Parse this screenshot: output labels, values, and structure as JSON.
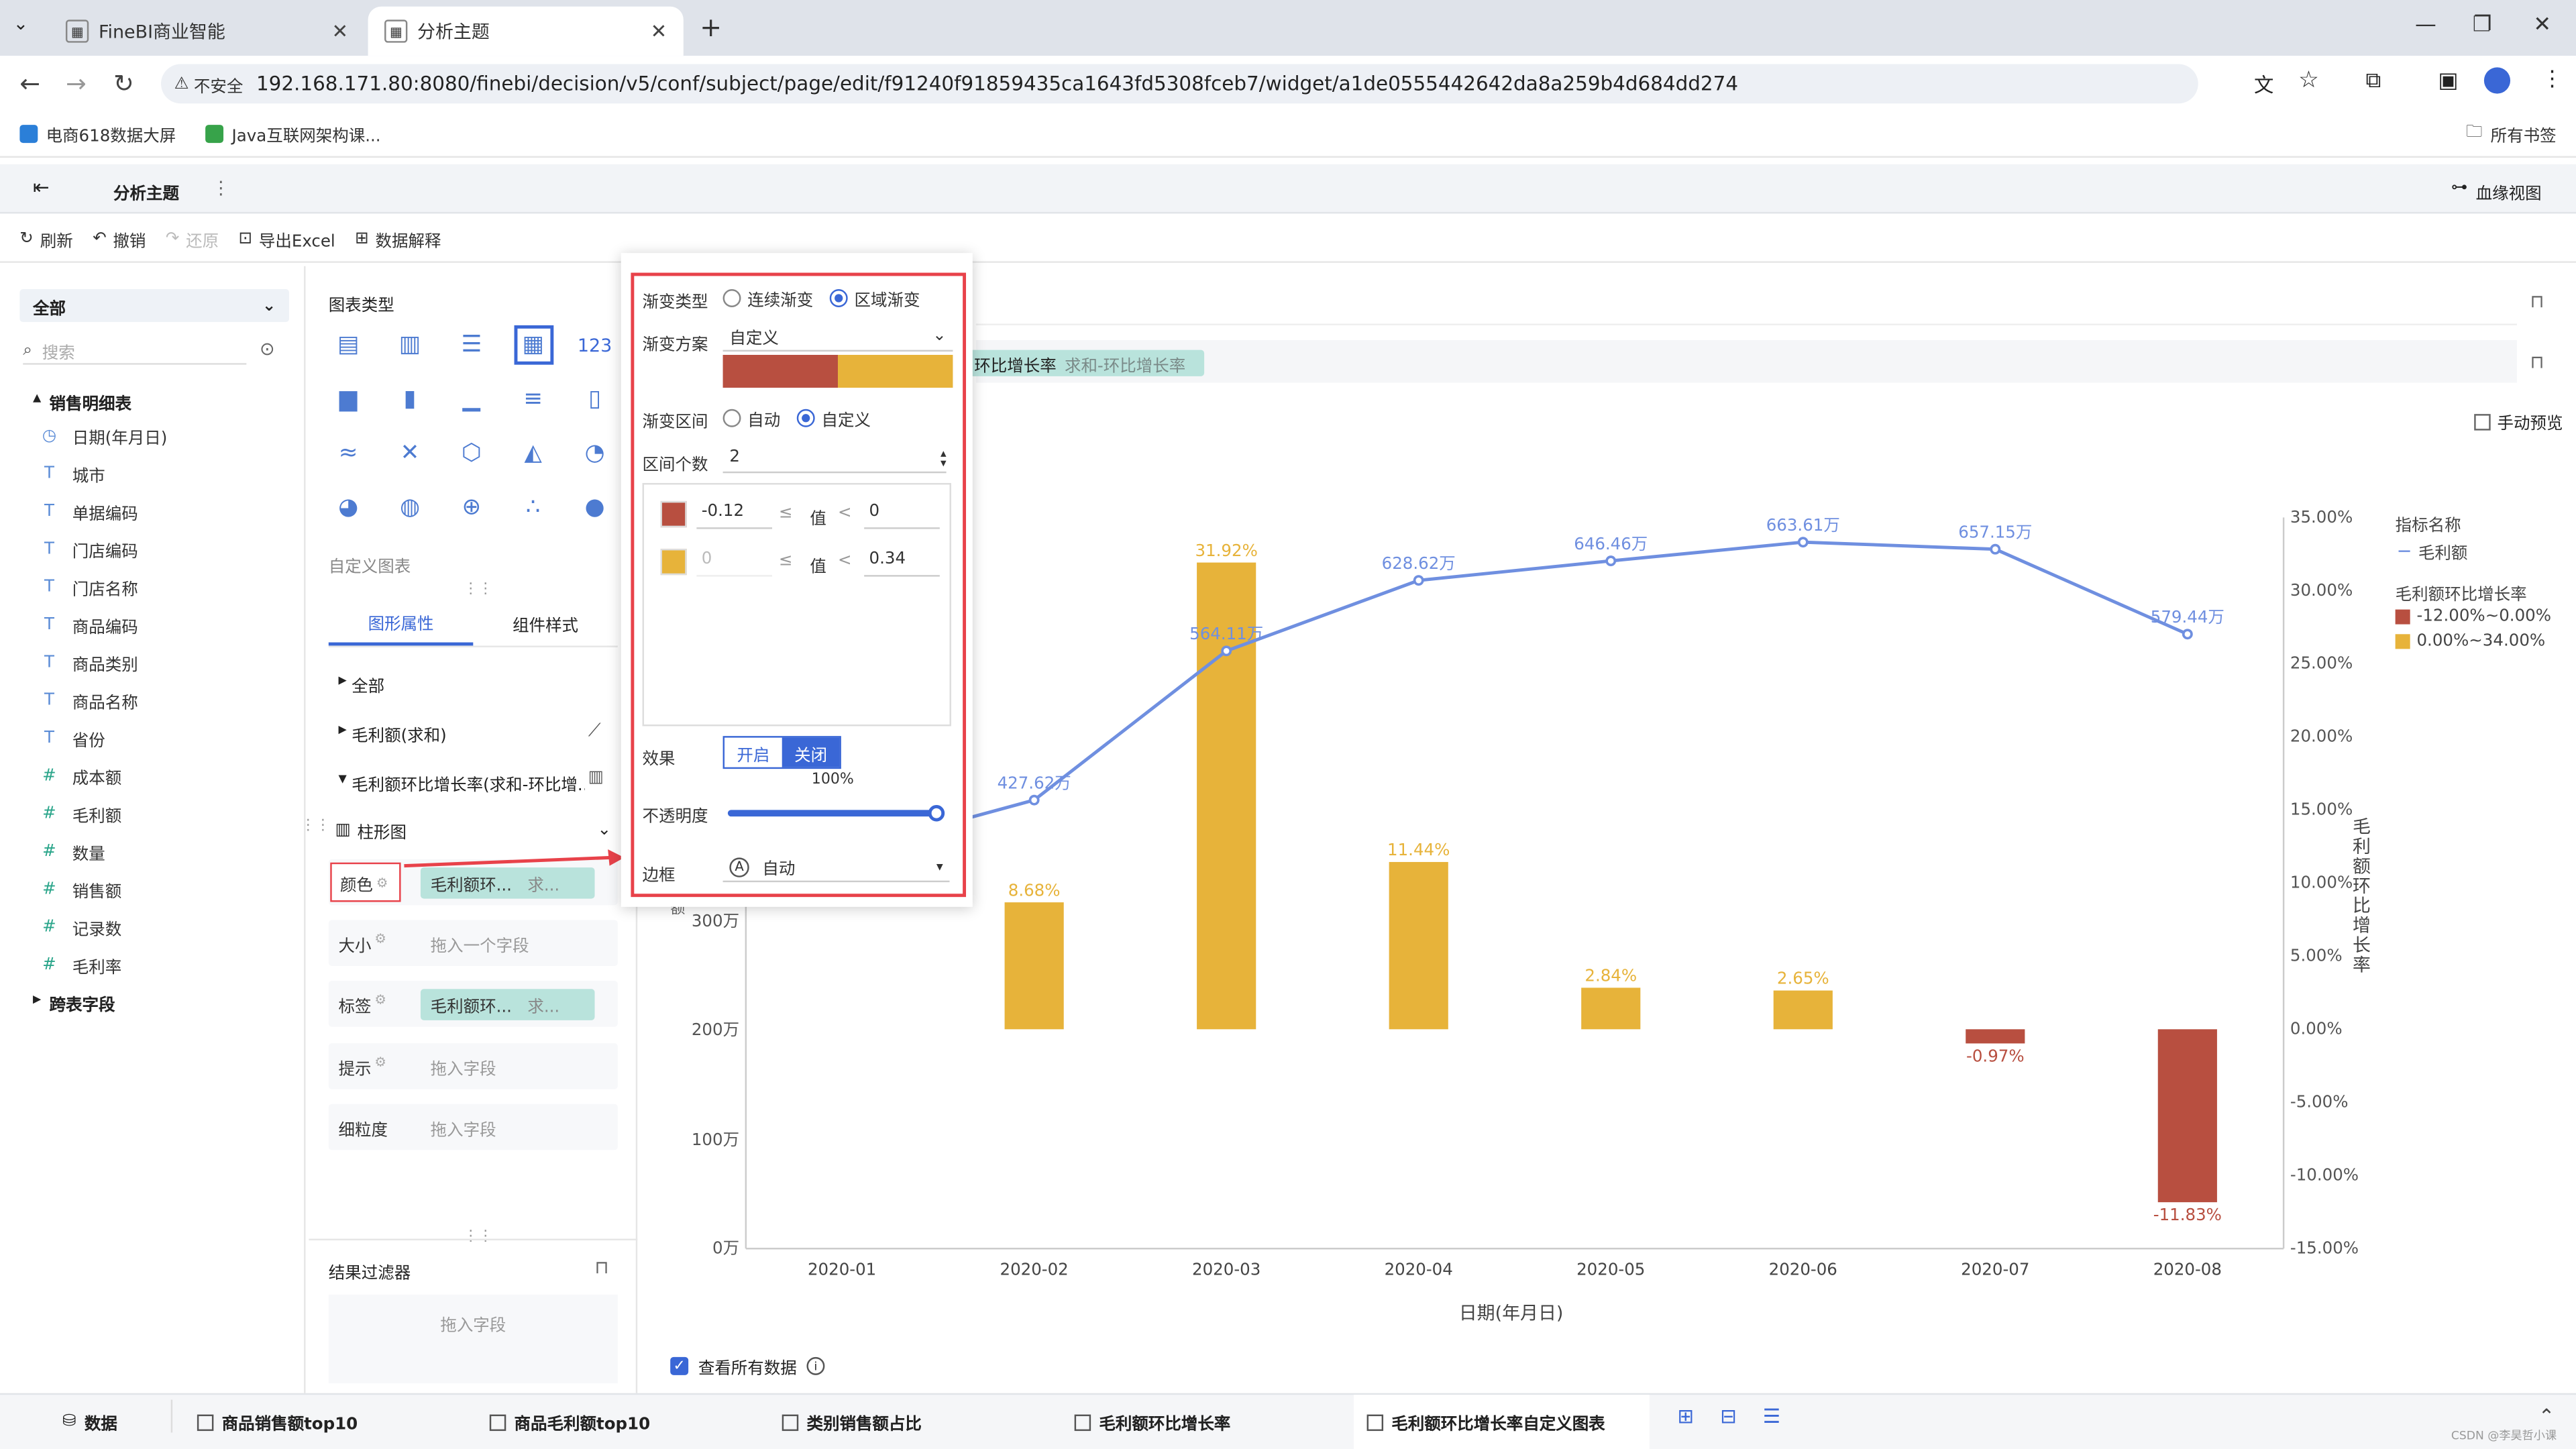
{
  "browser": {
    "tabs": [
      {
        "label": "FineBI商业智能"
      },
      {
        "label": "分析主题"
      }
    ],
    "insecure_label": "不安全",
    "url": "192.168.171.80:8080/finebi/decision/v5/conf/subject/page/edit/f91240f91859435ca1643fd5308fceb7/widget/a1de0555442642da8a259b4d684dd274",
    "bookmarks": [
      {
        "label": "电商618数据大屏"
      },
      {
        "label": "Java互联网架构课..."
      }
    ],
    "all_bookmarks": "所有书签"
  },
  "app": {
    "title": "分析主题",
    "lineage_view": "血缘视图",
    "toolbar": {
      "refresh": "刷新",
      "undo": "撤销",
      "redo": "还原",
      "export": "导出Excel",
      "explain": "数据解释"
    },
    "manual_preview": "手动预览"
  },
  "left": {
    "scope": "全部",
    "search_placeholder": "搜索",
    "table_name": "销售明细表",
    "fields": [
      {
        "type": "date",
        "label": "日期(年月日)"
      },
      {
        "type": "T",
        "label": "城市"
      },
      {
        "type": "T",
        "label": "单据编码"
      },
      {
        "type": "T",
        "label": "门店编码"
      },
      {
        "type": "T",
        "label": "门店名称"
      },
      {
        "type": "T",
        "label": "商品编码"
      },
      {
        "type": "T",
        "label": "商品类别"
      },
      {
        "type": "T",
        "label": "商品名称"
      },
      {
        "type": "T",
        "label": "省份"
      },
      {
        "type": "#",
        "label": "成本额"
      },
      {
        "type": "#",
        "label": "毛利额"
      },
      {
        "type": "#",
        "label": "数量"
      },
      {
        "type": "#",
        "label": "销售额"
      },
      {
        "type": "#",
        "label": "记录数"
      },
      {
        "type": "#f",
        "label": "毛利率"
      }
    ],
    "cross_table": "跨表字段"
  },
  "middle": {
    "chart_type_title": "图表类型",
    "custom_chart": "自定义图表",
    "tabs": {
      "attr": "图形属性",
      "style": "组件样式"
    },
    "tree": {
      "all": "全部",
      "profit_sum": "毛利额(求和)",
      "growth": "毛利额环比增长率(求和-环比增..."
    },
    "mark_type": "柱形图",
    "shelves": {
      "color": "颜色",
      "size": "大小",
      "label": "标签",
      "tooltip": "提示",
      "granularity": "细粒度",
      "chip": "毛利额环...",
      "chip_suffix": "求...",
      "size_placeholder": "拖入一个字段",
      "drag_placeholder": "拖入字段"
    },
    "result_filter": "结果过滤器",
    "filter_placeholder": "拖入字段"
  },
  "popup": {
    "gradient_type_label": "渐变类型",
    "continuous": "连续渐变",
    "region": "区域渐变",
    "scheme_label": "渐变方案",
    "scheme_value": "自定义",
    "scheme_colors": [
      "#b84f40",
      "#e7b33a"
    ],
    "interval_label": "渐变区间",
    "auto": "自动",
    "custom": "自定义",
    "count_label": "区间个数",
    "count_value": "2",
    "ranges": [
      {
        "color": "#b84f40",
        "from": "-0.12",
        "op1": "≤",
        "val": "值",
        "op2": "<",
        "to": "0"
      },
      {
        "color": "#e7b33a",
        "from": "0",
        "op1": "≤",
        "val": "值",
        "op2": "<",
        "to": "0.34"
      }
    ],
    "effect_label": "效果",
    "effect_on": "开启",
    "effect_off": "关闭",
    "opacity_label": "不透明度",
    "opacity_value": "100%",
    "opacity": 1.0,
    "border_label": "边框",
    "border_icon": "A",
    "border_value": "自动"
  },
  "chart": {
    "field_chip": "环比增长率",
    "field_chip_suffix": "求和-环比增长率",
    "show_all": "查看所有数据",
    "y_axis_partial": "额",
    "right_axis_title": "毛利额环比增长率"
  },
  "chart_data": {
    "type": "bar",
    "categories": [
      "2020-01",
      "2020-02",
      "2020-03",
      "2020-04",
      "2020-05",
      "2020-06",
      "2020-07",
      "2020-08"
    ],
    "xlabel": "日期(年月日)",
    "left_ticks": [
      "0万",
      "100万",
      "200万",
      "300万"
    ],
    "right_ticks": [
      "-15.00%",
      "-10.00%",
      "-5.00%",
      "0.00%",
      "5.00%",
      "10.00%",
      "15.00%",
      "20.00%",
      "25.00%",
      "30.00%",
      "35.00%"
    ],
    "right_ylim": [
      -15,
      35
    ],
    "bars": {
      "name": "毛利额环比增长率",
      "values": [
        null,
        8.68,
        31.92,
        11.44,
        2.84,
        2.65,
        -0.97,
        -11.83
      ],
      "labels": [
        "",
        "8.68%",
        "31.92%",
        "11.44%",
        "2.84%",
        "2.65%",
        "-0.97%",
        "-11.83%"
      ]
    },
    "line": {
      "name": "毛利额",
      "values": [
        null,
        427.62,
        564.11,
        628.62,
        646.46,
        663.61,
        657.15,
        579.44
      ],
      "labels": [
        "",
        "427.62万",
        "564.11万",
        "628.62万",
        "646.46万",
        "663.61万",
        "657.15万",
        "579.44万"
      ]
    },
    "legend": {
      "title1": "指标名称",
      "line_item": "毛利额",
      "title2": "毛利额环比增长率",
      "items": [
        {
          "label": "-12.00%~0.00%",
          "color": "#b84f40"
        },
        {
          "label": "0.00%~34.00%",
          "color": "#e7b33a"
        }
      ]
    },
    "colors": {
      "positive": "#e7b33a",
      "negative": "#b84f40",
      "line": "#6f8fe0"
    }
  },
  "bottom": {
    "data": "数据",
    "tabs": [
      {
        "label": "商品销售额top10"
      },
      {
        "label": "商品毛利额top10"
      },
      {
        "label": "类别销售额占比"
      },
      {
        "label": "毛利额环比增长率"
      },
      {
        "label": "毛利额环比增长率自定义图表"
      }
    ],
    "watermark": "CSDN @李昊哲小课"
  }
}
